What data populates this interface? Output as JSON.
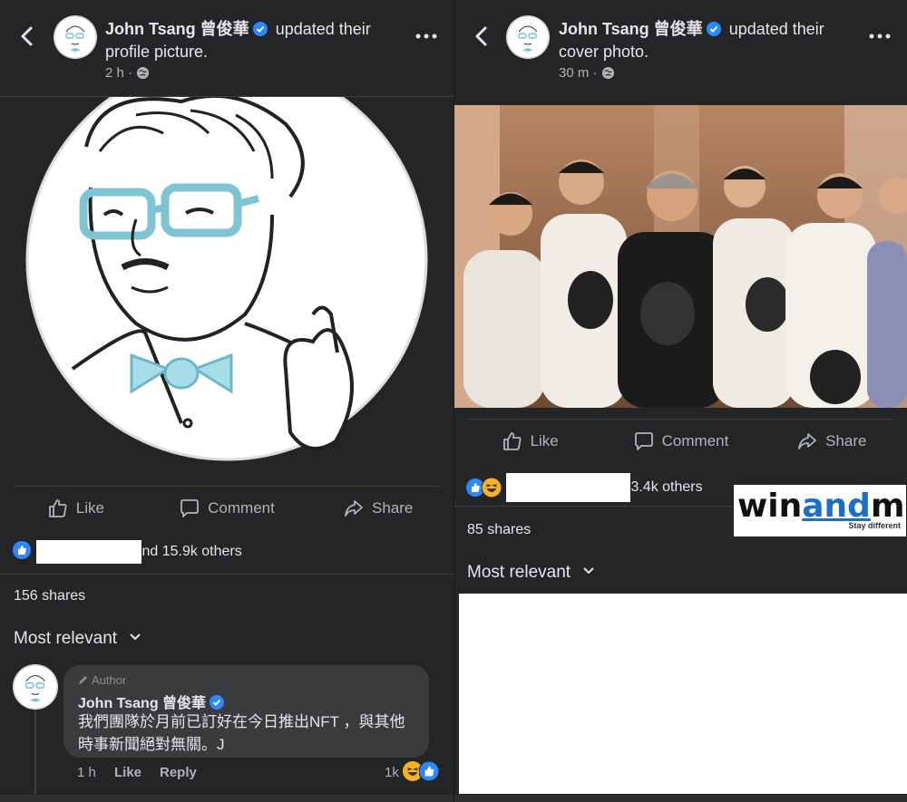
{
  "left_post": {
    "author": "John Tsang 曾俊華",
    "action": "updated their profile picture.",
    "time": "2 h ·",
    "actions": {
      "like": "Like",
      "comment": "Comment",
      "share": "Share"
    },
    "reactions_text": "nd 15.9k others",
    "shares": "156 shares",
    "sort": "Most relevant",
    "comment": {
      "author_tag": "Author",
      "name": "John Tsang 曾俊華",
      "text": "我們團隊於月前已訂好在今日推出NFT ，與其他時事新聞絕對無關。J",
      "time": "1 h",
      "like": "Like",
      "reply": "Reply",
      "reaction_count": "1k"
    }
  },
  "right_post": {
    "author": "John Tsang 曾俊華",
    "action": "updated their cover photo.",
    "time": "30 m ·",
    "actions": {
      "like": "Like",
      "comment": "Comment",
      "share": "Share"
    },
    "reactions_text": "3.4k others",
    "shares": "85 shares",
    "sort": "Most relevant"
  },
  "watermark": {
    "part1": "win",
    "part2": "and",
    "part3": "mac",
    "tagline": "Stay different"
  },
  "colors": {
    "background": "#242526",
    "text": "#e4e6eb",
    "muted": "#b0b3b8",
    "accent": "#2d88ff",
    "glasses": "#7fc4d4"
  }
}
